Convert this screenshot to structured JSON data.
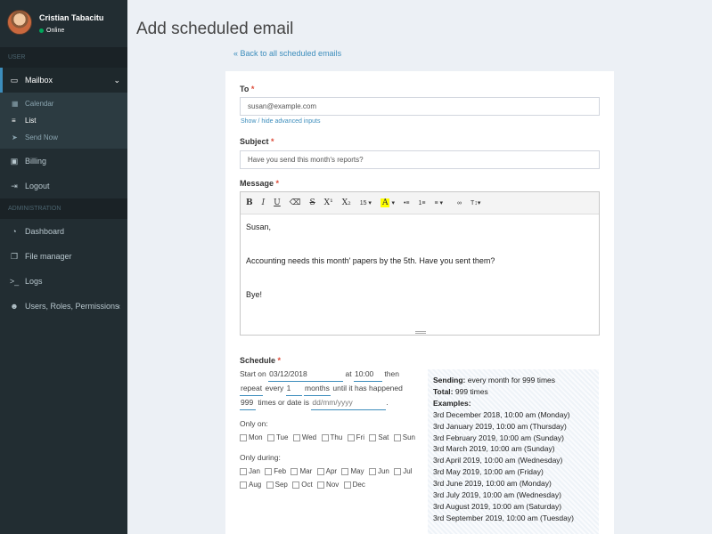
{
  "user": {
    "name": "Cristian Tabacitu",
    "status": "Online"
  },
  "sidebar": {
    "section_user": "USER",
    "mailbox": "Mailbox",
    "sub": [
      {
        "label": "Calendar",
        "icon": "calendar-icon"
      },
      {
        "label": "List",
        "icon": "list-icon"
      },
      {
        "label": "Send Now",
        "icon": "paper-plane-icon"
      }
    ],
    "billing": "Billing",
    "logout": "Logout",
    "section_admin": "ADMINISTRATION",
    "dashboard": "Dashboard",
    "file_manager": "File manager",
    "logs": "Logs",
    "users": "Users, Roles, Permissions"
  },
  "page": {
    "title": "Add scheduled email",
    "back": "« Back to all scheduled emails"
  },
  "form": {
    "to_label": "To",
    "to_value": "susan@example.com",
    "adv_link": "Show / hide advanced inputs",
    "subject_label": "Subject",
    "subject_value": "Have you send this month's reports?",
    "message_label": "Message",
    "toolbar": {
      "bold": "B",
      "italic": "I",
      "underline": "U",
      "eraser": "⌫",
      "strike": "S",
      "sup": "X¹",
      "sub": "X₂",
      "font_size": "15 ▾",
      "highlight": "A",
      "caret": "▾",
      "ul": "•≡",
      "ol": "1≡",
      "align": "≡ ▾",
      "link": "∞",
      "text_style": "T↕▾"
    },
    "message_lines": [
      "Susan,",
      "",
      "Accounting needs this month' papers by the 5th. Have you sent them?",
      "",
      "Bye!"
    ],
    "schedule_label": "Schedule"
  },
  "schedule": {
    "start_on": "Start on",
    "date": "03/12/2018",
    "at": "at",
    "time": "10:00",
    "then": "then",
    "repeat": "repeat",
    "every": "every",
    "every_n": "1",
    "unit": "months",
    "until": "until it has happened",
    "times_n": "999",
    "times_or_date": "times or date is",
    "date_placeholder": "dd/mm/yyyy",
    "period": ".",
    "only_on": "Only on:",
    "days": [
      "Mon",
      "Tue",
      "Wed",
      "Thu",
      "Fri",
      "Sat",
      "Sun"
    ],
    "only_during": "Only during:",
    "months": [
      "Jan",
      "Feb",
      "Mar",
      "Apr",
      "May",
      "Jun",
      "Jul",
      "Aug",
      "Sep",
      "Oct",
      "Nov",
      "Dec"
    ]
  },
  "summary": {
    "sending_label": "Sending:",
    "sending_value": "every month for 999 times",
    "total_label": "Total:",
    "total_value": "999 times",
    "examples_label": "Examples:",
    "examples": [
      "3rd December 2018, 10:00 am (Monday)",
      "3rd January 2019, 10:00 am (Thursday)",
      "3rd February 2019, 10:00 am (Sunday)",
      "3rd March 2019, 10:00 am (Sunday)",
      "3rd April 2019, 10:00 am (Wednesday)",
      "3rd May 2019, 10:00 am (Friday)",
      "3rd June 2019, 10:00 am (Monday)",
      "3rd July 2019, 10:00 am (Wednesday)",
      "3rd August 2019, 10:00 am (Saturday)",
      "3rd September 2019, 10:00 am (Tuesday)"
    ]
  },
  "colors": {
    "sidebar": "#222d32",
    "accent": "#3c8dbc",
    "required": "#dd4b39",
    "online": "#00a65a"
  }
}
